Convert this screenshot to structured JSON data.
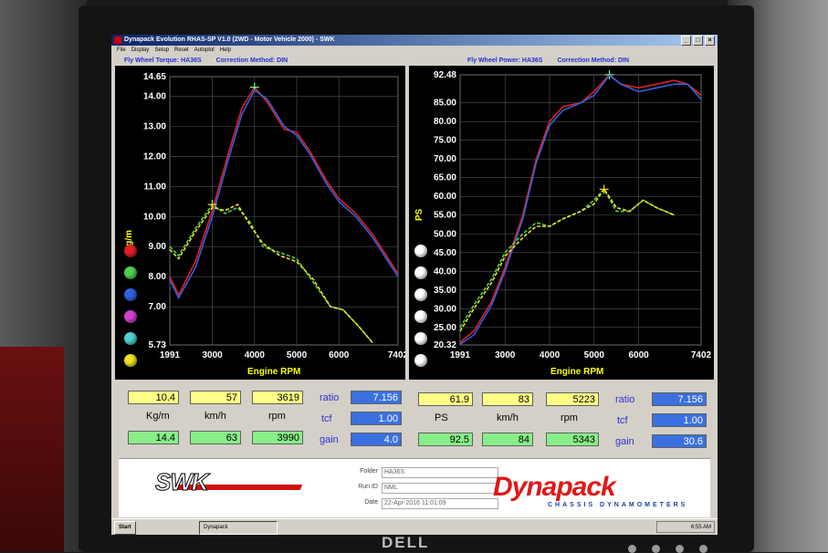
{
  "window": {
    "title": "Dynapack Evolution RHAS-SP V1.0  (2WD - Motor Vehicle 2000) - SWK"
  },
  "menu": [
    "File",
    "Display",
    "Setup",
    "Reset",
    "Autoplot",
    "Help"
  ],
  "torque_graph": {
    "header_title": "Fly Wheel Torque: HA36S",
    "header_method": "Correction Method: DIN",
    "ylabel": "Kg/m",
    "xlabel": "Engine RPM",
    "yticks": [
      "14.65",
      "14.00",
      "13.00",
      "12.00",
      "11.00",
      "10.00",
      "9.00",
      "8.00",
      "7.00",
      "5.73"
    ],
    "xticks": [
      "1991",
      "3000",
      "4000",
      "5000",
      "6000",
      "7402"
    ]
  },
  "power_graph": {
    "header_title": "Fly Wheel Power: HA36S",
    "header_method": "Correction Method: DIN",
    "ylabel": "PS",
    "xlabel": "Engine RPM",
    "yticks": [
      "92.48",
      "85.00",
      "80.00",
      "75.00",
      "70.00",
      "65.00",
      "60.00",
      "55.00",
      "50.00",
      "45.00",
      "40.00",
      "35.00",
      "30.00",
      "25.00",
      "20.32"
    ],
    "xticks": [
      "1991",
      "3000",
      "4000",
      "5000",
      "6000",
      "7402"
    ]
  },
  "run_colors": [
    "#e02020",
    "#50d050",
    "#3060e0",
    "#d040d0",
    "#50d0d0",
    "#f0e020"
  ],
  "left_panel": {
    "row1": [
      "10.4",
      "57",
      "3619"
    ],
    "units": [
      "Kg/m",
      "km/h",
      "rpm"
    ],
    "row2": [
      "14.4",
      "63",
      "3990"
    ],
    "labels": [
      "ratio",
      "tcf",
      "gain"
    ],
    "values": [
      "7.156",
      "1.00",
      "4.0"
    ]
  },
  "right_panel": {
    "row1": [
      "61.9",
      "83",
      "5223"
    ],
    "units": [
      "PS",
      "km/h",
      "rpm"
    ],
    "row2": [
      "92.5",
      "84",
      "5343"
    ],
    "labels": [
      "ratio",
      "tcf",
      "gain"
    ],
    "values": [
      "7.156",
      "1.00",
      "30.6"
    ]
  },
  "footer": {
    "logo": "SWK",
    "folder_label": "Folder",
    "folder_value": "HA36S",
    "runid_label": "Run ID",
    "runid_value": "NML",
    "date_label": "Date",
    "date_value": "22-Apr-2016  11:01:09",
    "brand": "Dynapack",
    "brand_sub": "CHASSIS DYNAMOMETERS"
  },
  "taskbar": {
    "start": "Start",
    "task": "Dynapack",
    "clock": "6:55 AM"
  },
  "monitor_brand": "DELL",
  "chart_data": [
    {
      "type": "line",
      "title": "Fly Wheel Torque: HA36S",
      "xlabel": "Engine RPM",
      "ylabel": "Kg/m",
      "xlim": [
        1991,
        7402
      ],
      "ylim": [
        5.73,
        14.65
      ],
      "grid": true,
      "series": [
        {
          "color": "#e02020",
          "x": [
            1991,
            2200,
            2600,
            3000,
            3400,
            3700,
            4000,
            4300,
            4700,
            5000,
            5300,
            5700,
            6000,
            6400,
            6800,
            7402
          ],
          "y": [
            8.0,
            7.4,
            8.5,
            10.2,
            12.2,
            13.6,
            14.3,
            13.8,
            12.9,
            12.8,
            12.2,
            11.2,
            10.6,
            10.1,
            9.4,
            8.1
          ]
        },
        {
          "color": "#3060e0",
          "x": [
            1991,
            2200,
            2600,
            3000,
            3400,
            3700,
            4000,
            4300,
            4700,
            5000,
            5300,
            5700,
            6000,
            6400,
            6800,
            7402
          ],
          "y": [
            7.9,
            7.3,
            8.3,
            10.0,
            12.0,
            13.4,
            14.2,
            13.9,
            13.0,
            12.7,
            12.1,
            11.1,
            10.5,
            10.0,
            9.3,
            8.0
          ]
        },
        {
          "color": "#50d050",
          "x": [
            1991,
            2200,
            2600,
            3000,
            3300,
            3600,
            3900,
            4200,
            4600,
            5000,
            5400,
            5800,
            6100,
            6500,
            6800
          ],
          "y": [
            9.0,
            8.7,
            9.6,
            10.4,
            10.1,
            10.3,
            9.8,
            9.0,
            8.8,
            8.6,
            7.8,
            7.0,
            6.9,
            6.3,
            5.8
          ]
        },
        {
          "color": "#f0e020",
          "x": [
            1991,
            2200,
            2600,
            3000,
            3300,
            3600,
            3900,
            4200,
            4600,
            5000,
            5400,
            5800,
            6100,
            6500,
            6800
          ],
          "y": [
            8.9,
            8.6,
            9.5,
            10.3,
            10.2,
            10.4,
            9.7,
            9.1,
            8.7,
            8.5,
            7.9,
            7.0,
            6.9,
            6.3,
            5.8
          ]
        }
      ]
    },
    {
      "type": "line",
      "title": "Fly Wheel Power: HA36S",
      "xlabel": "Engine RPM",
      "ylabel": "PS",
      "xlim": [
        1991,
        7402
      ],
      "ylim": [
        20.32,
        92.48
      ],
      "grid": true,
      "series": [
        {
          "color": "#e02020",
          "x": [
            1991,
            2300,
            2700,
            3000,
            3400,
            3700,
            4000,
            4300,
            4700,
            5000,
            5343,
            5600,
            6000,
            6400,
            6800,
            7100,
            7402
          ],
          "y": [
            21,
            24,
            32,
            41,
            55,
            70,
            80,
            84,
            85,
            88,
            92.5,
            90,
            89,
            90,
            91,
            90,
            87
          ]
        },
        {
          "color": "#3060e0",
          "x": [
            1991,
            2300,
            2700,
            3000,
            3400,
            3700,
            4000,
            4300,
            4700,
            5000,
            5343,
            5600,
            6000,
            6400,
            6800,
            7100,
            7402
          ],
          "y": [
            20.5,
            23,
            31,
            40,
            54,
            69,
            79,
            83,
            85,
            87,
            92.3,
            90,
            88,
            89,
            90,
            90,
            86
          ]
        },
        {
          "color": "#50d050",
          "x": [
            1991,
            2300,
            2700,
            3000,
            3400,
            3700,
            4000,
            4300,
            4700,
            5000,
            5223,
            5500,
            5800,
            6100,
            6400,
            6800
          ],
          "y": [
            25,
            31,
            38,
            45,
            50,
            53,
            52,
            54,
            56,
            59,
            61.9,
            56,
            56,
            59,
            57,
            55
          ]
        },
        {
          "color": "#f0e020",
          "x": [
            1991,
            2300,
            2700,
            3000,
            3400,
            3700,
            4000,
            4300,
            4700,
            5000,
            5223,
            5500,
            5800,
            6100,
            6400,
            6800
          ],
          "y": [
            24,
            30,
            37,
            44,
            49,
            52,
            52,
            54,
            56,
            58,
            62,
            57,
            56,
            59,
            57,
            55
          ]
        }
      ]
    }
  ]
}
